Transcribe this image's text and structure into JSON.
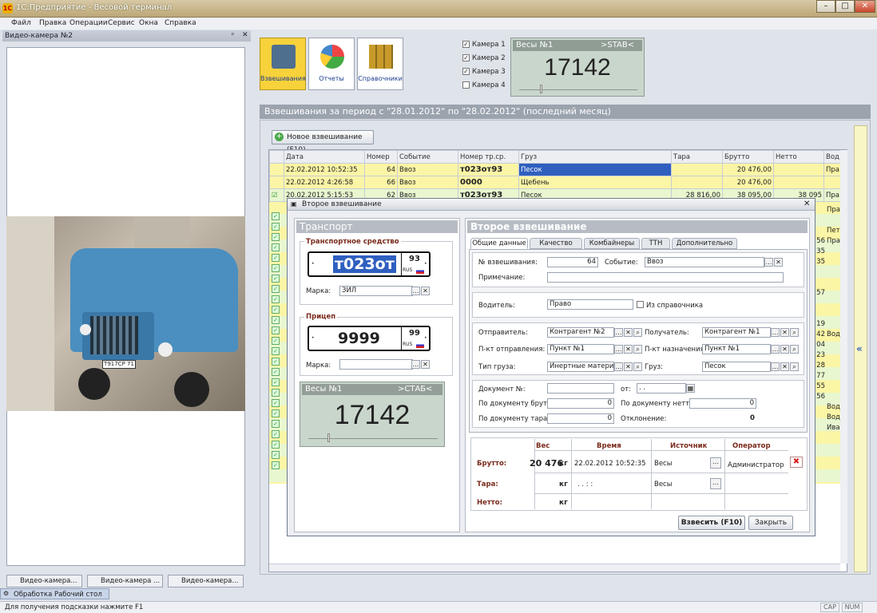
{
  "window": {
    "title": "1С:Предприятие - Весовой терминал",
    "logo": "1С"
  },
  "menu": [
    "Файл",
    "Правка",
    "Операции",
    "Сервис",
    "Окна",
    "Справка"
  ],
  "camera_panel": {
    "title": "Видео-камера №2",
    "plate_text": "Т917СР 71"
  },
  "toolbar": {
    "weigh_label": "Взвешивания",
    "reports_label": "Отчеты",
    "refs_label": "Справочники"
  },
  "cameras": [
    {
      "label": "Камера 1",
      "checked": true
    },
    {
      "label": "Камера 2",
      "checked": true
    },
    {
      "label": "Камера 3",
      "checked": true
    },
    {
      "label": "Камера 4",
      "checked": false
    }
  ],
  "scale_top": {
    "name": "Весы №1",
    "status": ">STAB<",
    "value": "17142"
  },
  "list": {
    "title": "Взвешивания за период с \"28.01.2012\" по \"28.02.2012\" (последний месяц)",
    "new_button": "Новое взвешивание (F10)",
    "columns": [
      "Дата",
      "Номер",
      "Событие",
      "Номер тр.ср.",
      "Груз",
      "Тара",
      "Брутто",
      "Нетто",
      "Вод"
    ],
    "rows": [
      [
        "22.02.2012 10:52:35",
        "64",
        "Ввоз",
        "т023от93",
        "Песок",
        "",
        "20 476,00",
        "",
        "Пра"
      ],
      [
        "22.02.2012 4:26:58",
        "66",
        "Ввоз",
        "0000",
        "Щебень",
        "",
        "20 476,00",
        "",
        ""
      ],
      [
        "20.02.2012 5:15:53",
        "62",
        "Ввоз",
        "т023от93",
        "Песок",
        "28 816,00",
        "38 095,00",
        "38 095",
        "Пра"
      ]
    ],
    "right_col": [
      "Пра",
      "",
      "Пет",
      "Пра",
      "",
      "",
      "",
      "",
      "",
      "",
      "",
      "",
      "Вод",
      "",
      "",
      "",
      "",
      "",
      "",
      "Вод",
      "Вод",
      "Ива",
      "",
      "",
      ""
    ],
    "right_nums": [
      "",
      "",
      "",
      "56",
      "35",
      "35",
      "",
      "",
      "57",
      "",
      "",
      "19",
      "42",
      "04",
      "23",
      "28",
      "77",
      "55",
      "56",
      "",
      "",
      "",
      "",
      "",
      ""
    ]
  },
  "dialog": {
    "title": "Второе взвешивание",
    "transport": {
      "header": "Транспорт",
      "vehicle_group": "Транспортное средство",
      "plate_main": "т023от",
      "plate_region": "93",
      "rus": "RUS",
      "brand_label": "Марка:",
      "brand_value": "ЗИЛ",
      "trailer_group": "Прицеп",
      "trailer_main": "9999",
      "trailer_region": "99",
      "trailer_rus": "RUS",
      "trailer_brand_label": "Марка:",
      "trailer_brand_value": ""
    },
    "scale": {
      "name": "Весы №1",
      "status": ">СТАБ<",
      "value": "17142"
    },
    "second": {
      "header": "Второе взвешивание",
      "tabs": [
        "Общие данные",
        "Качество",
        "Комбайнеры",
        "ТТН",
        "Дополнительно"
      ],
      "num_label": "№ взвешивания:",
      "num_value": "64",
      "event_label": "Событие:",
      "event_value": "Ввоз",
      "note_label": "Примечание:",
      "driver_label": "Водитель:",
      "driver_value": "Право",
      "from_ref_label": "Из справочника",
      "sender_label": "Отправитель:",
      "sender_value": "Контрагент №2",
      "receiver_label": "Получатель:",
      "receiver_value": "Контрагент №1",
      "from_label": "П-кт отправления:",
      "from_value": "Пункт №1",
      "to_label": "П-кт назначения:",
      "to_value": "Пункт №1",
      "cargo_type_label": "Тип груза:",
      "cargo_type_value": "Инертные материал",
      "cargo_label": "Груз:",
      "cargo_value": "Песок",
      "doc_label": "Документ №:",
      "doc_from_label": "от:",
      "doc_date": ". .",
      "doc_gross_label": "По документу брутто:",
      "doc_gross_value": "0",
      "doc_net_label": "По документу нетто:",
      "doc_net_value": "0",
      "doc_tare_label": "По документу тара:",
      "doc_tare_value": "0",
      "dev_label": "Отклонение:",
      "dev_value": "0"
    },
    "weights": {
      "headers": [
        "Вес",
        "Время",
        "Источник",
        "Оператор"
      ],
      "gross_label": "Брутто:",
      "gross_value": "20 476",
      "gross_unit": "кг",
      "gross_time": "22.02.2012 10:52:35",
      "gross_source": "Весы",
      "gross_operator": "Администратор",
      "tare_label": "Тара:",
      "tare_unit": "кг",
      "tare_time": ". .   : :",
      "tare_source": "Весы",
      "net_label": "Нетто:",
      "net_unit": "кг"
    },
    "weigh_button": "Взвесить (F10)",
    "close_button": "Закрыть"
  },
  "bottom_tabs": [
    "Видео-камера...",
    "Видео-камера ...",
    "Видео-камера..."
  ],
  "taskbar": {
    "item": "Обработка  Рабочий стол"
  },
  "status": {
    "hint": "Для получения подсказки нажмите F1",
    "cap": "CAP",
    "num": "NUM"
  }
}
